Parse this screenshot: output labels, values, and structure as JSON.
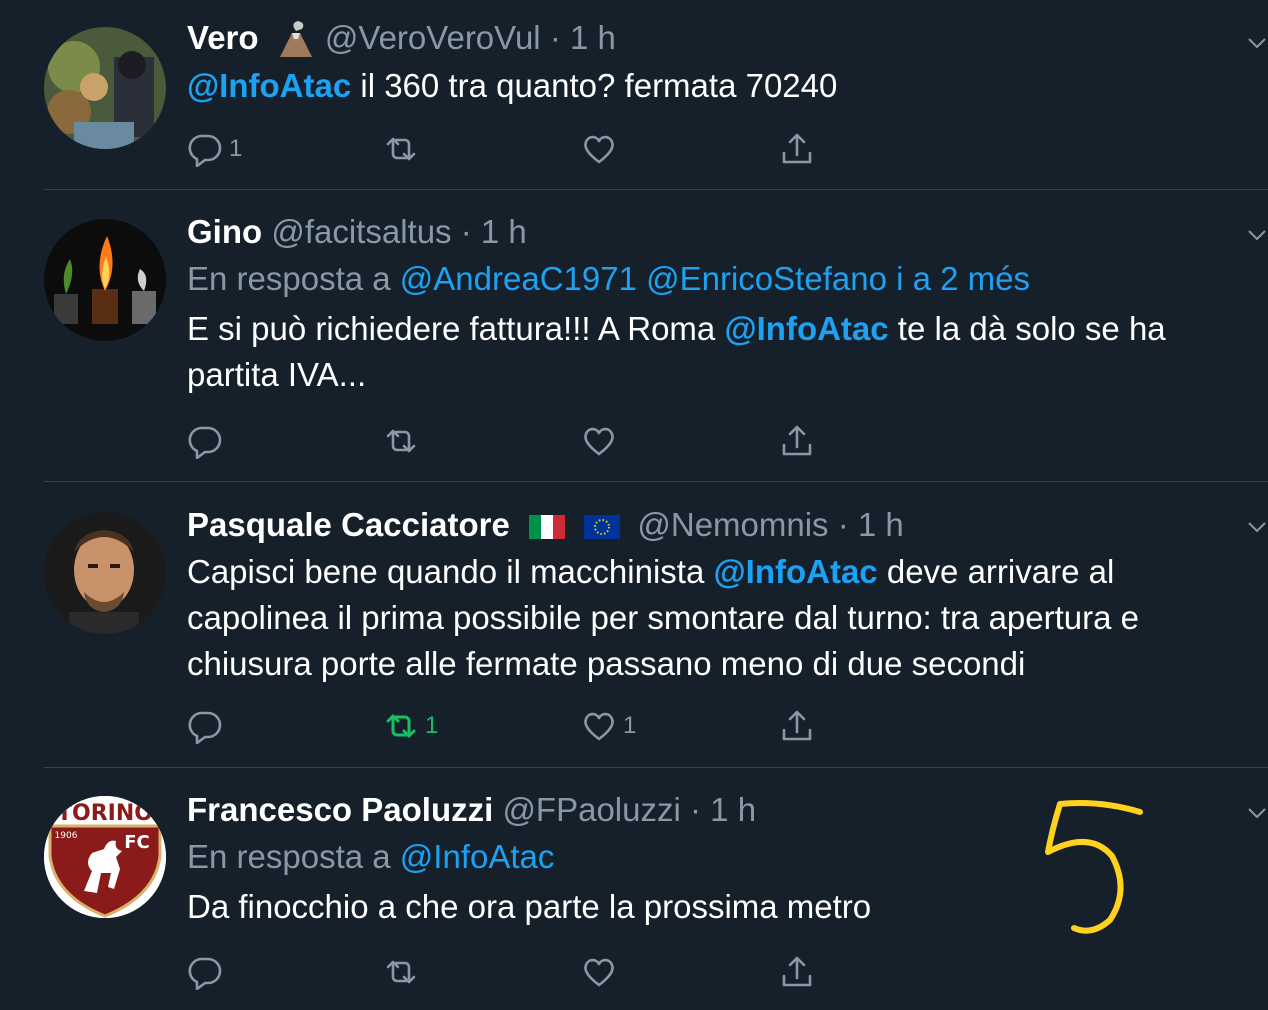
{
  "tweets": [
    {
      "name": "Vero",
      "handle": "@VeroVeroVul",
      "dot": "·",
      "time": "1 h",
      "mention": "@InfoAtac",
      "text": " il 360 tra quanto? fermata 70240",
      "replies": "1",
      "retweets": "",
      "likes": ""
    },
    {
      "name": "Gino",
      "handle": "@facitsaltus",
      "dot": "·",
      "time": "1 h",
      "reply_prefix": "En resposta a ",
      "reply_targets": "@AndreaC1971 @EnricoStefano i a 2 més",
      "text_before": "E si può richiedere fattura!!! A Roma ",
      "mention": "@InfoAtac",
      "text_after": " te la dà solo se ha partita IVA...",
      "replies": "",
      "retweets": "",
      "likes": ""
    },
    {
      "name": "Pasquale Cacciatore",
      "handle": "@Nemomnis",
      "dot": "·",
      "time": "1 h",
      "text_before": "Capisci bene quando il macchinista ",
      "mention": "@InfoAtac",
      "text_after": " deve arrivare al capolinea il prima possibile per smontare dal turno: tra apertura e chiusura porte alle fermate passano meno di due secondi",
      "replies": "",
      "retweets": "1",
      "likes": "1"
    },
    {
      "name": "Francesco Paoluzzi",
      "handle": "@FPaoluzzi",
      "dot": "·",
      "time": "1 h",
      "reply_prefix": "En resposta a ",
      "reply_targets": "@InfoAtac",
      "text": "Da finocchio a che ora parte la prossima metro",
      "avatar_logo_text": "TORINO FC 1906",
      "replies": "",
      "retweets": "",
      "likes": ""
    }
  ],
  "colors": {
    "background": "#15202b",
    "muted": "#8899a6",
    "link": "#1da1f2",
    "retweeted": "#17bf63",
    "annotation": "#ffd21f"
  },
  "icons": [
    "reply-icon",
    "retweet-icon",
    "like-icon",
    "share-icon",
    "chevron-down-icon",
    "volcano-emoji-icon",
    "italy-flag-icon",
    "eu-flag-icon"
  ]
}
